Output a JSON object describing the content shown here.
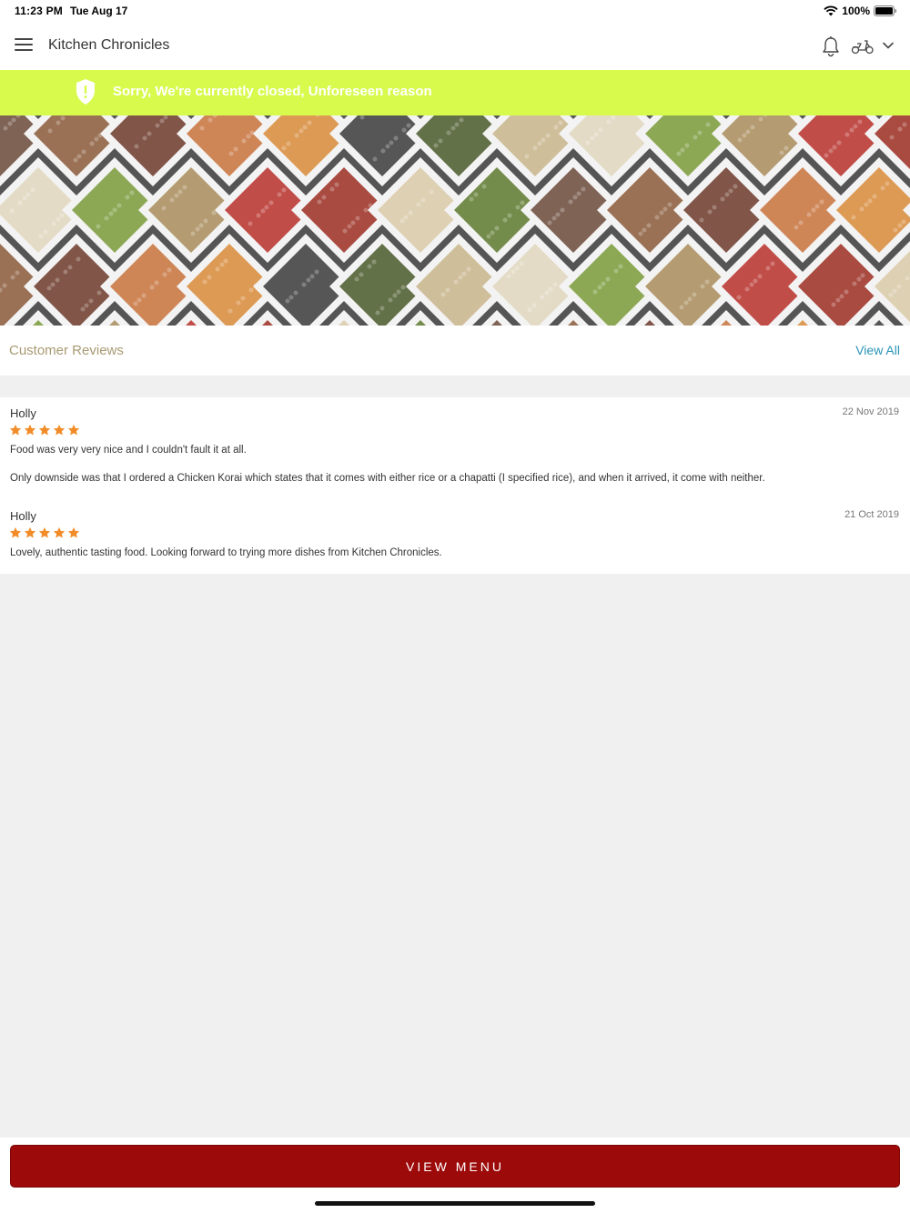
{
  "status_bar": {
    "time": "11:23 PM",
    "date": "Tue Aug 17",
    "battery": "100%"
  },
  "header": {
    "title": "Kitchen Chronicles",
    "icons": [
      "menu-icon",
      "bell-icon",
      "scooter-icon",
      "chevron-down-icon"
    ]
  },
  "banner": {
    "text": "Sorry, We're currently closed, Unforeseen reason",
    "icon": "shield-alert-icon",
    "color": "#d7fa4d"
  },
  "hero": {
    "image": "spices"
  },
  "reviews": {
    "title": "Customer Reviews",
    "view_all": "View All",
    "items": [
      {
        "author": "Holly",
        "date": "22 Nov 2019",
        "rating": 5,
        "text": "Food was very very nice and I couldn't fault it at all.",
        "text2": "Only downside was that I ordered a Chicken Korai which states that it comes with either rice or a chapatti (I specified rice), and when it arrived, it come with neither."
      },
      {
        "author": "Holly",
        "date": "21 Oct 2019",
        "rating": 5,
        "text": "Lovely, authentic tasting food. Looking forward to trying more dishes from Kitchen Chronicles."
      }
    ]
  },
  "footer": {
    "view_menu": "VIEW MENU",
    "button_color": "#9c0a0a"
  },
  "colors": {
    "star": "#f28c28",
    "link": "#2a95b8",
    "reviews_title": "#a89a72"
  }
}
